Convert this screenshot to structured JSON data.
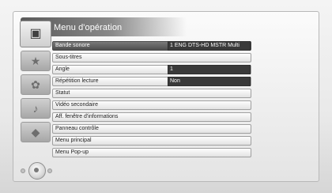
{
  "menu": {
    "title": "Menu d'opération",
    "items": [
      {
        "label": "Bande sonore",
        "value": "1 ENG DTS-HD MSTR Multi",
        "selected": true
      },
      {
        "label": "Sous-titres",
        "value": null
      },
      {
        "label": "Angle",
        "value": "1"
      },
      {
        "label": "Répétition lecture",
        "value": "Non"
      },
      {
        "label": "Statut",
        "value": null
      },
      {
        "label": "Vidéo secondaire",
        "value": null
      },
      {
        "label": "Aff. fenêtre d'informations",
        "value": null
      },
      {
        "label": "Panneau contrôle",
        "value": null
      },
      {
        "label": "Menu principal",
        "value": null
      },
      {
        "label": "Menu Pop-up",
        "value": null
      }
    ]
  },
  "sidebar": {
    "icons": [
      {
        "name": "disc-tools-icon",
        "glyph": "▣",
        "active": true
      },
      {
        "name": "star-icon",
        "glyph": "★"
      },
      {
        "name": "settings-icon",
        "glyph": "✿"
      },
      {
        "name": "music-note-icon",
        "glyph": "♪"
      },
      {
        "name": "cube-icon",
        "glyph": "◆"
      }
    ]
  },
  "controls": {
    "navigation": "dpad-icon"
  }
}
